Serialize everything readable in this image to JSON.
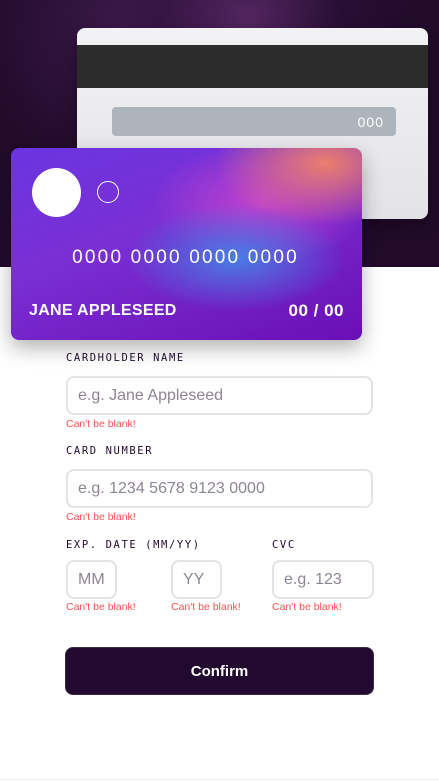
{
  "card_back": {
    "cvc_value": "000"
  },
  "card_front": {
    "number": "0000 0000 0000 0000",
    "name": "JANE APPLESEED",
    "expiry": "00 / 00"
  },
  "form": {
    "cardholder": {
      "label": "Cardholder Name",
      "placeholder": "e.g. Jane Appleseed",
      "value": "",
      "error": "Can't be blank!"
    },
    "card_number": {
      "label": "Card Number",
      "placeholder": "e.g. 1234 5678 9123 0000",
      "value": "",
      "error": "Can't be blank!"
    },
    "exp_date": {
      "label": "Exp. Date (MM/YY)",
      "month_placeholder": "MM",
      "year_placeholder": "YY",
      "month_error": "Can't be blank!",
      "year_error": "Can't be blank!"
    },
    "cvc": {
      "label": "CVC",
      "placeholder": "e.g. 123",
      "error": "Can't be blank!"
    },
    "confirm_label": "Confirm"
  },
  "colors": {
    "hero_background": "#220b2b",
    "button_background": "#21092f",
    "error_text": "#ff5050",
    "input_border": "#e6e2e8",
    "card_gradient_start": "#6a35e0",
    "card_gradient_end": "#6a0fb5"
  }
}
